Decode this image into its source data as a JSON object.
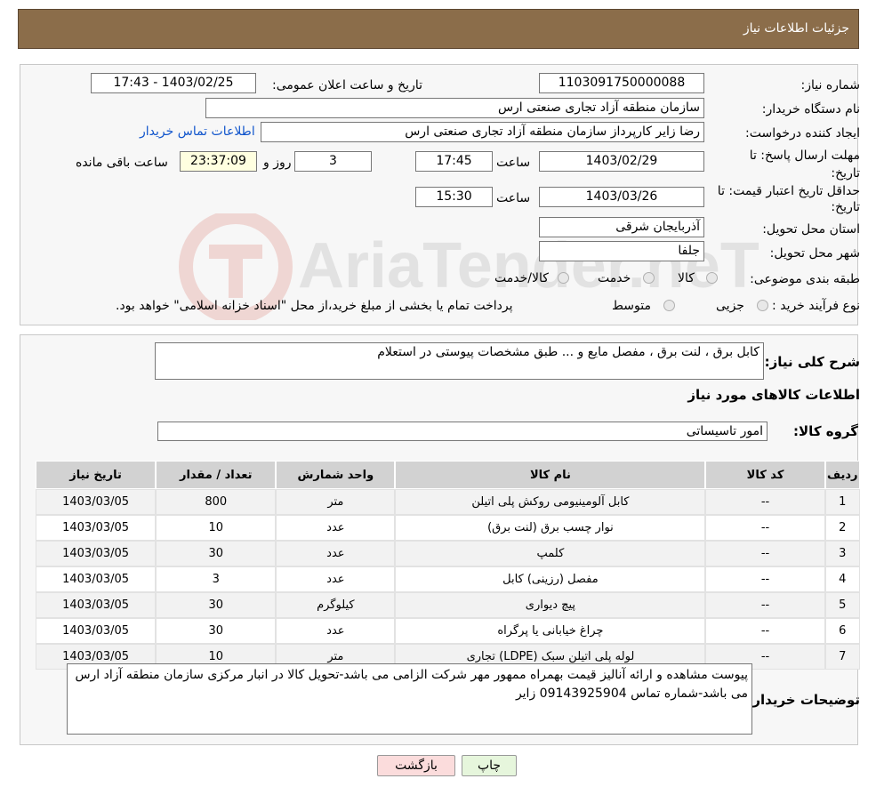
{
  "header": {
    "title": "جزئیات اطلاعات نیاز"
  },
  "watermark": {
    "text": "AriaTender.neT"
  },
  "info": {
    "need_number_label": "شماره نیاز:",
    "need_number": "1103091750000088",
    "announce_label": "تاریخ و ساعت اعلان عمومی:",
    "announce_value": "1403/02/25 - 17:43",
    "buyer_org_label": "نام دستگاه خریدار:",
    "buyer_org": "سازمان منطقه آزاد تجاری صنعتی ارس",
    "creator_label": "ایجاد کننده درخواست:",
    "creator": "رضا زایر کارپرداز سازمان منطقه آزاد تجاری صنعتی ارس",
    "contact_link": "اطلاعات تماس خریدار",
    "deadline_label": "مهلت ارسال پاسخ: تا تاریخ:",
    "deadline_date": "1403/02/29",
    "time_label": "ساعت",
    "deadline_time": "17:45",
    "days": "3",
    "days_label": "روز و",
    "remaining": "23:37:09",
    "remaining_label": "ساعت باقی مانده",
    "validity_label": "حداقل تاریخ اعتبار قیمت: تا تاریخ:",
    "validity_date": "1403/03/26",
    "validity_time": "15:30",
    "province_label": "استان محل تحویل:",
    "province": "آذربایجان شرقی",
    "city_label": "شهر محل تحویل:",
    "city": "جلفا",
    "category_label": "طبقه بندی موضوعی:",
    "category_options": [
      "کالا",
      "خدمت",
      "کالا/خدمت"
    ],
    "process_label": "نوع فرآیند خرید :",
    "process_options": [
      "جزیی",
      "متوسط"
    ],
    "process_note": "پرداخت تمام یا بخشی از مبلغ خرید،از محل \"اسناد خزانه اسلامی\" خواهد بود."
  },
  "details": {
    "description_label": "شرح کلی نیاز:",
    "description": "کابل برق ، لنت برق ، مفصل مایع و ... طبق مشخصات پیوستی در استعلام",
    "goods_info_title": "اطلاعات کالاهای مورد نیاز",
    "goods_group_label": "گروه کالا:",
    "goods_group": "امور تاسیساتی",
    "table": {
      "headers": [
        "ردیف",
        "کد کالا",
        "نام کالا",
        "واحد شمارش",
        "تعداد / مقدار",
        "تاریخ نیاز"
      ],
      "rows": [
        [
          "1",
          "--",
          "کابل آلومینیومی روکش پلی اتیلن",
          "متر",
          "800",
          "1403/03/05"
        ],
        [
          "2",
          "--",
          "نوار چسب برق (لنت برق)",
          "عدد",
          "10",
          "1403/03/05"
        ],
        [
          "3",
          "--",
          "کلمپ",
          "عدد",
          "30",
          "1403/03/05"
        ],
        [
          "4",
          "--",
          "مفصل (رزینی) کابل",
          "عدد",
          "3",
          "1403/03/05"
        ],
        [
          "5",
          "--",
          "پیچ دیواری",
          "کیلوگرم",
          "30",
          "1403/03/05"
        ],
        [
          "6",
          "--",
          "چراغ خیابانی یا پرگراه",
          "عدد",
          "30",
          "1403/03/05"
        ],
        [
          "7",
          "--",
          "لوله پلی اتیلن سبک (LDPE) تجاری",
          "متر",
          "10",
          "1403/03/05"
        ]
      ]
    },
    "buyer_notes_label": "توضیحات خریدار:",
    "buyer_notes": "پیوست مشاهده و ارائه آنالیز قیمت بهمراه ممهور مهر شرکت الزامی می باشد-تحویل کالا در انبار مرکزی سازمان منطقه آزاد ارس می باشد-شماره تماس 09143925904 زایر"
  },
  "buttons": {
    "print": "چاپ",
    "back": "بازگشت"
  },
  "colors": {
    "header": "#8b6d4a",
    "print_btn": "#e6f6dc",
    "back_btn": "#fbdcdc",
    "remaining_bg": "#ffffe0"
  }
}
